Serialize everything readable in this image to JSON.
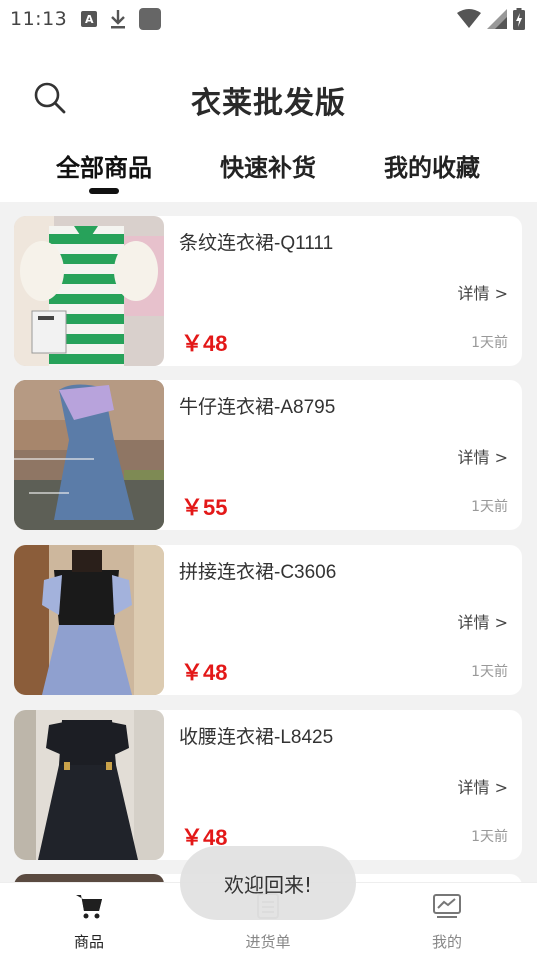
{
  "status_bar": {
    "time": "11:13"
  },
  "header": {
    "title": "衣莱批发版"
  },
  "tabs": [
    {
      "label": "全部商品",
      "active": true
    },
    {
      "label": "快速补货",
      "active": false
    },
    {
      "label": "我的收藏",
      "active": false
    }
  ],
  "products": [
    {
      "name": "条纹连衣裙-Q1111",
      "detail": "详情 >",
      "price": "￥48",
      "time": "1天前"
    },
    {
      "name": "牛仔连衣裙-A8795",
      "detail": "详情 >",
      "price": "￥55",
      "time": "1天前"
    },
    {
      "name": "拼接连衣裙-C3606",
      "detail": "详情 >",
      "price": "￥48",
      "time": "1天前"
    },
    {
      "name": "收腰连衣裙-L8425",
      "detail": "详情 >",
      "price": "￥48",
      "time": "1天前"
    }
  ],
  "toast": "欢迎回来!",
  "bottom_nav": [
    {
      "label": "商品",
      "icon": "cart-icon",
      "active": true
    },
    {
      "label": "进货单",
      "icon": "list-icon",
      "active": false
    },
    {
      "label": "我的",
      "icon": "chart-icon",
      "active": false
    }
  ],
  "colors": {
    "price": "#e31818",
    "list_background": "#f2f2f2",
    "active_text": "#222222",
    "inactive_text": "#888888"
  }
}
